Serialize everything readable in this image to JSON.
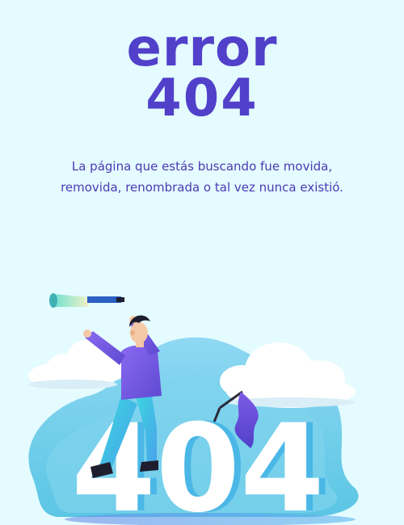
{
  "hero": {
    "line1": "error",
    "line2": "404"
  },
  "message": {
    "text": "La página que estás buscando fue movida, removida, renombrada o tal vez nunca existió."
  },
  "illustration": {
    "big_number": "404",
    "colors": {
      "background": "#e4fbff",
      "accent": "#5140c9",
      "blob": "#5bc9e8",
      "character_shirt": "#7c5ce6",
      "character_pants": "#38c7d9"
    }
  }
}
